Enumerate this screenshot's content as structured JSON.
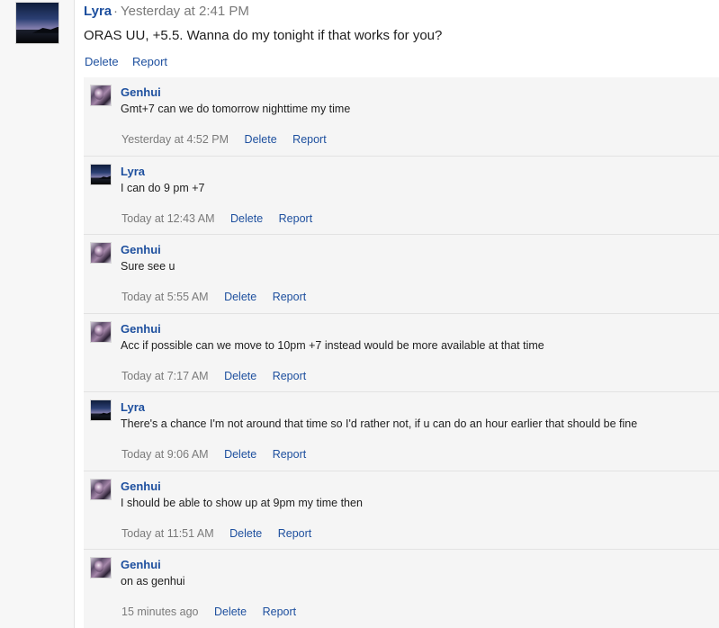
{
  "root": {
    "author": "Lyra",
    "separator": "·",
    "time": "Yesterday at 2:41 PM",
    "text": "ORAS UU, +5.5. Wanna do my tonight if that works for you?",
    "delete_label": "Delete",
    "report_label": "Report"
  },
  "replies": [
    {
      "author": "Genhui",
      "avatar": "genhui",
      "text": "Gmt+7 can we do tomorrow nighttime my time",
      "time": "Yesterday at 4:52 PM",
      "delete_label": "Delete",
      "report_label": "Report"
    },
    {
      "author": "Lyra",
      "avatar": "lyra",
      "text": "I can do 9 pm +7",
      "time": "Today at 12:43 AM",
      "delete_label": "Delete",
      "report_label": "Report"
    },
    {
      "author": "Genhui",
      "avatar": "genhui",
      "text": "Sure see u",
      "time": "Today at 5:55 AM",
      "delete_label": "Delete",
      "report_label": "Report"
    },
    {
      "author": "Genhui",
      "avatar": "genhui",
      "text": "Acc if possible can we move to 10pm +7 instead would be more available at that time",
      "time": "Today at 7:17 AM",
      "delete_label": "Delete",
      "report_label": "Report"
    },
    {
      "author": "Lyra",
      "avatar": "lyra",
      "text": "There's a chance I'm not around that time so I'd rather not, if u can do an hour earlier that should be fine",
      "time": "Today at 9:06 AM",
      "delete_label": "Delete",
      "report_label": "Report"
    },
    {
      "author": "Genhui",
      "avatar": "genhui",
      "text": "I should be able to show up at 9pm my time then",
      "time": "Today at 11:51 AM",
      "delete_label": "Delete",
      "report_label": "Report"
    },
    {
      "author": "Genhui",
      "avatar": "genhui",
      "text": "on as genhui",
      "time": "15 minutes ago",
      "delete_label": "Delete",
      "report_label": "Report"
    }
  ],
  "colors": {
    "link": "#1d4f9e",
    "muted": "#7a7a7a",
    "reply_bg": "#f5f5f5"
  }
}
